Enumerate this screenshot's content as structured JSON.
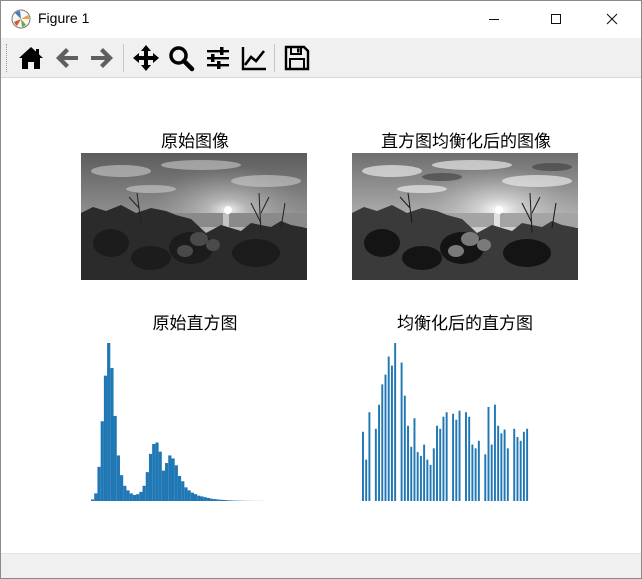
{
  "window": {
    "title": "Figure 1",
    "controls": [
      "minimize",
      "maximize",
      "close"
    ]
  },
  "toolbar": {
    "tools": [
      {
        "name": "home",
        "icon": "home-icon"
      },
      {
        "name": "back",
        "icon": "arrow-left-icon"
      },
      {
        "name": "forward",
        "icon": "arrow-right-icon"
      },
      {
        "name": "pan",
        "icon": "move-icon"
      },
      {
        "name": "zoom",
        "icon": "magnifier-icon"
      },
      {
        "name": "subplots",
        "icon": "sliders-icon"
      },
      {
        "name": "edit-axes",
        "icon": "line-chart-icon"
      },
      {
        "name": "save",
        "icon": "floppy-disk-icon"
      }
    ]
  },
  "figure": {
    "titles": {
      "original_image": "原始图像",
      "equalized_image": "直方图均衡化后的图像",
      "original_hist": "原始直方图",
      "equalized_hist": "均衡化后的直方图"
    },
    "bar_color": "#1f77b4"
  },
  "chart_data": [
    {
      "type": "bar",
      "title": "原始直方图",
      "x": [
        0,
        4,
        8,
        12,
        16,
        20,
        24,
        28,
        32,
        36,
        40,
        44,
        48,
        52,
        56,
        60,
        64,
        68,
        72,
        76,
        80,
        84,
        88,
        92,
        96,
        100,
        104,
        108,
        112,
        116,
        120,
        124,
        128,
        132,
        136,
        140,
        144,
        148,
        152,
        156,
        160,
        164,
        168,
        172,
        176,
        180,
        184,
        188,
        192,
        196,
        200,
        204,
        208,
        212,
        216,
        220,
        224,
        228,
        232,
        236,
        240,
        244,
        248,
        252
      ],
      "values": [
        2,
        10,
        45,
        105,
        165,
        208,
        175,
        112,
        60,
        34,
        20,
        14,
        10,
        8,
        9,
        12,
        20,
        38,
        62,
        75,
        77,
        65,
        40,
        50,
        60,
        56,
        47,
        33,
        26,
        18,
        14,
        11,
        9,
        7,
        6,
        5,
        4,
        3,
        2.5,
        2,
        1.6,
        1.3,
        1,
        0.8,
        0.6,
        0.5,
        0.4,
        0.3,
        0.2,
        0.2,
        0.1,
        0.1,
        0.1,
        0.1,
        0,
        0,
        0,
        0,
        0,
        0,
        0,
        0,
        0,
        0
      ]
    },
    {
      "type": "bar",
      "title": "均衡化后的直方图",
      "x": [
        0,
        4,
        8,
        12,
        16,
        20,
        24,
        28,
        32,
        36,
        40,
        44,
        48,
        52,
        56,
        60,
        64,
        68,
        72,
        76,
        80,
        84,
        88,
        92,
        96,
        100,
        104,
        108,
        112,
        116,
        120,
        124,
        128,
        132,
        136,
        140,
        144,
        148,
        152,
        156,
        160,
        164,
        168,
        172,
        176,
        180,
        184,
        188,
        192,
        196,
        200,
        204,
        208,
        212,
        216,
        220,
        224,
        228,
        232,
        236,
        240,
        244,
        248,
        252
      ],
      "values": [
        92,
        55,
        118,
        0,
        96,
        128,
        155,
        168,
        192,
        180,
        210,
        0,
        184,
        140,
        100,
        72,
        110,
        65,
        60,
        75,
        55,
        48,
        70,
        100,
        96,
        112,
        118,
        0,
        116,
        108,
        120,
        0,
        118,
        112,
        75,
        70,
        80,
        0,
        62,
        125,
        75,
        128,
        100,
        90,
        95,
        70,
        0,
        96,
        85,
        80,
        92,
        96,
        0,
        0,
        0,
        0,
        0,
        0,
        0,
        0,
        0,
        0,
        0,
        0
      ]
    }
  ]
}
